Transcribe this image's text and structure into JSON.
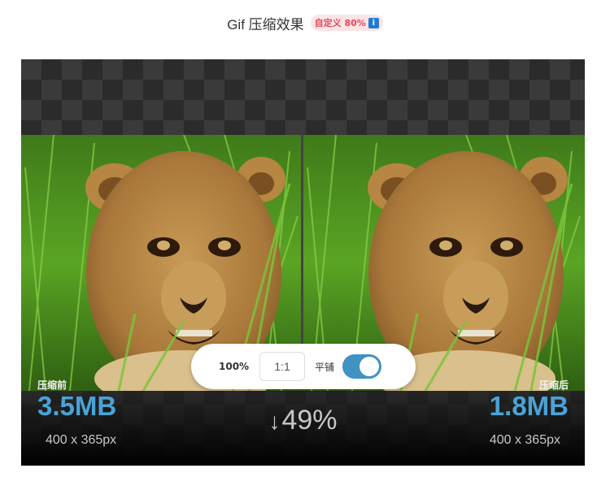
{
  "header": {
    "title": "Gif 压缩效果",
    "badge_label": "自定义 80%",
    "info_icon": "info-icon",
    "info_glyph": "i"
  },
  "comparison": {
    "before": {
      "label": "压缩前",
      "size": "3.5MB",
      "dimensions": "400 x 365px"
    },
    "after": {
      "label": "压缩后",
      "size": "1.8MB",
      "dimensions": "400 x 365px"
    },
    "reduction_arrow": "↓",
    "reduction": "49%"
  },
  "controls": {
    "zoom": "100%",
    "ratio_button": "1:1",
    "tile_label": "平铺",
    "tile_enabled": true
  },
  "colors": {
    "accent": "#4aa3d6",
    "badge_bg": "#fde3e6",
    "badge_text": "#e2475b",
    "toggle_on": "#3f92c2"
  }
}
